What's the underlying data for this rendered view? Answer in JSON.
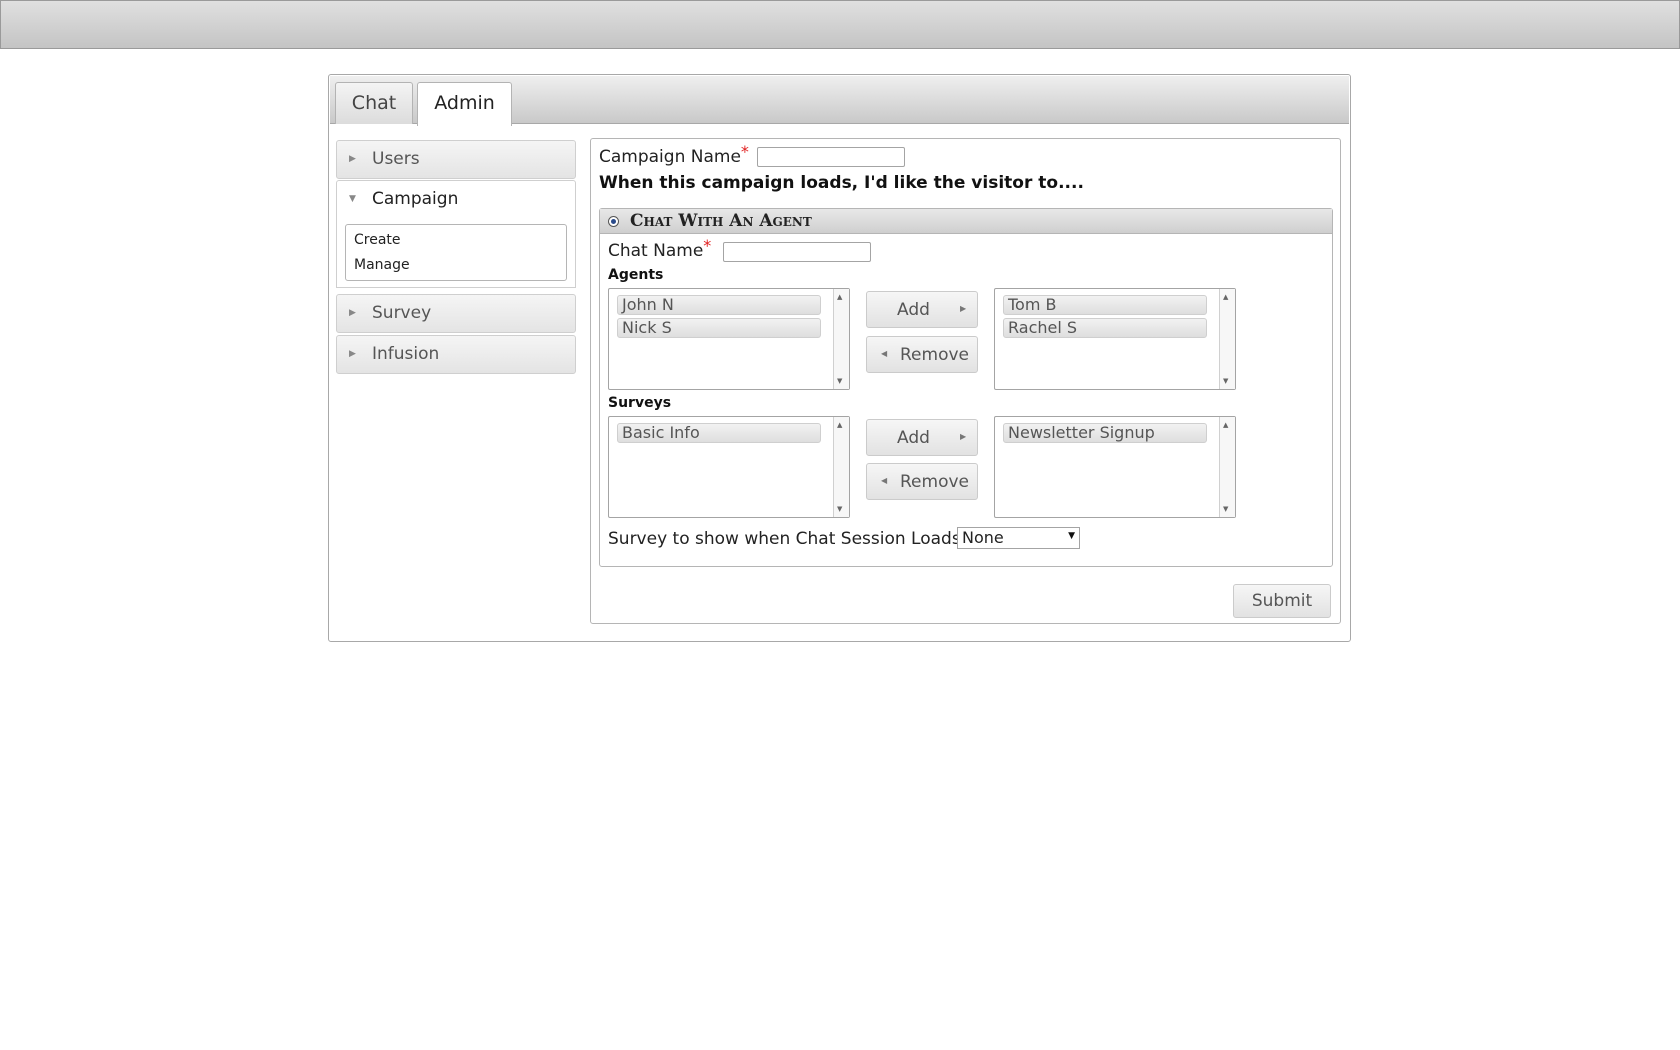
{
  "tabs": [
    "Chat",
    "Admin"
  ],
  "sidebar": {
    "sections": [
      "Users",
      "Campaign",
      "Survey",
      "Infusion"
    ],
    "campaign_items": [
      "Create",
      "Manage"
    ]
  },
  "form": {
    "campaign_name_label": "Campaign Name",
    "required_mark": "*",
    "campaign_name_value": "",
    "intro_text": "When this campaign loads, I'd like the visitor to....",
    "section_title": "Chat With An Agent",
    "chat_name_label": "Chat Name",
    "chat_name_value": "",
    "agents_label": "Agents",
    "agents_available": [
      "John N",
      "Nick S"
    ],
    "agents_selected": [
      "Tom B",
      "Rachel S"
    ],
    "surveys_label": "Surveys",
    "surveys_available": [
      "Basic Info"
    ],
    "surveys_selected": [
      "Newsletter Signup"
    ],
    "add_label": "Add",
    "remove_label": "Remove",
    "survey_show_label": "Survey to show when Chat Session Loads",
    "survey_show_value": "None",
    "submit_label": "Submit"
  }
}
